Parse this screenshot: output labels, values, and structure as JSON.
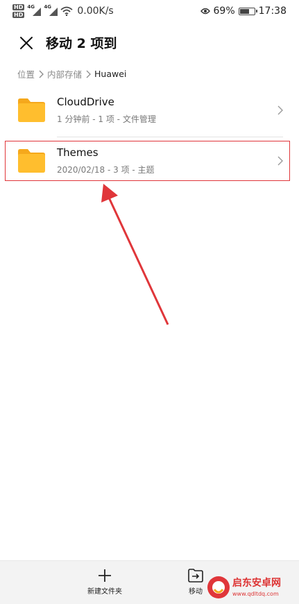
{
  "status_bar": {
    "hd1": "HD",
    "hd2": "HD",
    "sim1_type": "4G",
    "sim2_type": "4G",
    "network_speed": "0.00K/s",
    "battery_percent": "69%",
    "battery_level": 0.69,
    "time": "17:38"
  },
  "header": {
    "title": "移动 2 项到"
  },
  "breadcrumb": {
    "items": [
      "位置",
      "内部存储",
      "Huawei"
    ]
  },
  "folders": [
    {
      "name": "CloudDrive",
      "meta": "1 分钟前 - 1 项 - 文件管理"
    },
    {
      "name": "Themes",
      "meta": "2020/02/18 - 3 项 - 主题"
    }
  ],
  "bottom_bar": {
    "new_folder_label": "新建文件夹",
    "move_label": "移动"
  },
  "watermark": {
    "name": "启东安卓网",
    "url": "www.qdltdq.com"
  },
  "colors": {
    "folder": "#FFBE2E",
    "folder_tab": "#F5A81C",
    "annotation": "#E0363A"
  }
}
